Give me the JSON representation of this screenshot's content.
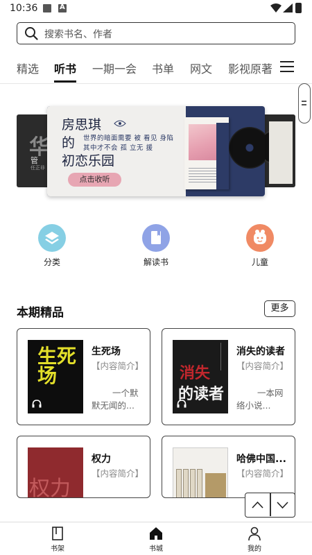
{
  "status_bar": {
    "time": "10:36"
  },
  "search": {
    "placeholder": "搜索书名、作者"
  },
  "tabs": [
    {
      "label": "精选",
      "active": false
    },
    {
      "label": "听书",
      "active": true
    },
    {
      "label": "一期一会",
      "active": false
    },
    {
      "label": "书单",
      "active": false
    },
    {
      "label": "网文",
      "active": false
    },
    {
      "label": "影视原著",
      "active": false
    }
  ],
  "banner": {
    "left_book": {
      "big_char": "华",
      "subtitle": "管",
      "small_text": "任正非"
    },
    "main": {
      "title_lines": [
        "房思琪",
        "的",
        "初恋乐园"
      ],
      "tagline": "世界的暗面需要 被 看见 身陷其中才不会 孤 立无 援",
      "button_label": "点击收听"
    }
  },
  "quick_links": [
    {
      "label": "分类",
      "icon": "layers-icon",
      "color": "#86cfe4"
    },
    {
      "label": "解读书",
      "icon": "book-icon",
      "color": "#8fa3e6"
    },
    {
      "label": "儿童",
      "icon": "child-icon",
      "color": "#f08a64"
    }
  ],
  "section": {
    "title": "本期精品",
    "more_label": "更多"
  },
  "books": [
    {
      "title": "生死场",
      "desc_head": "【内容简介】",
      "desc_body": "一个默默无闻的...",
      "cover_text": "生死场"
    },
    {
      "title": "消失的读者",
      "desc_head": "【内容简介】",
      "desc_body": "一本网络小说...",
      "cover_text": "的读者",
      "cover_text_red": "消失"
    },
    {
      "title": "权力",
      "desc_head": "【内容简介】",
      "cover_text": "权力"
    },
    {
      "title": "哈佛中国...",
      "desc_head": "【内容简介】"
    }
  ],
  "bottom_nav": [
    {
      "label": "书架",
      "icon": "bookshelf-icon"
    },
    {
      "label": "书城",
      "icon": "home-icon",
      "active": true
    },
    {
      "label": "我的",
      "icon": "profile-icon"
    }
  ]
}
